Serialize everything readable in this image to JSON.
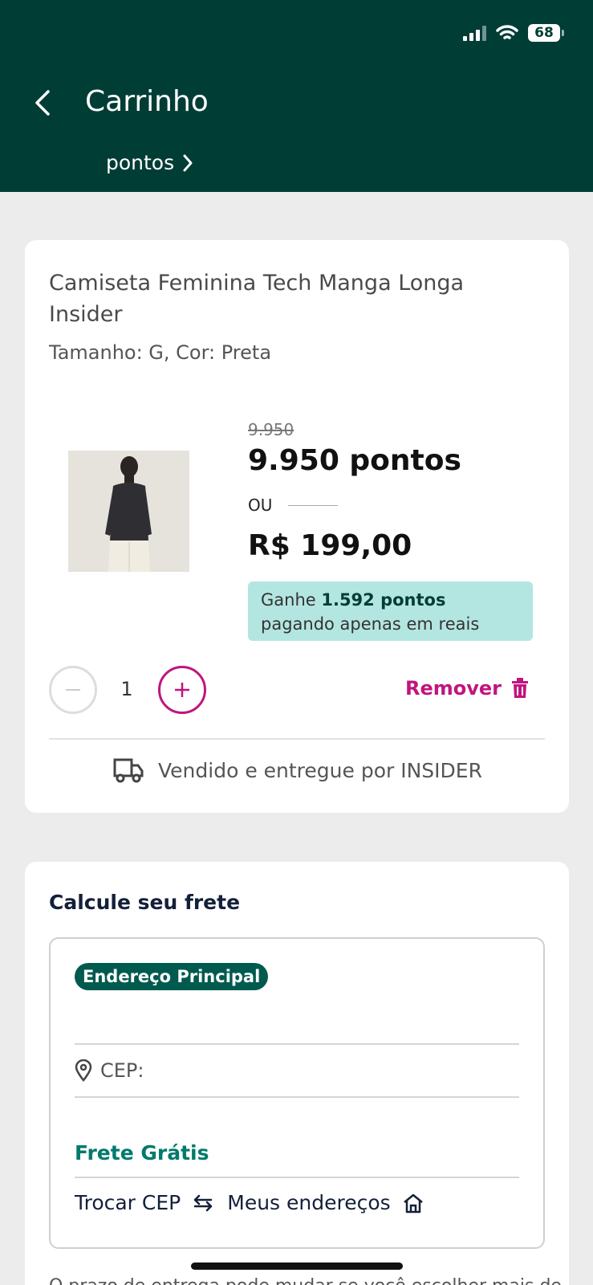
{
  "status_bar": {
    "battery": "68"
  },
  "header": {
    "title": "Carrinho",
    "points_label": "pontos"
  },
  "product": {
    "name": "Camiseta Feminina Tech Manga Longa Insider",
    "variant": "Tamanho: G, Cor: Preta",
    "old_price": "9.950",
    "points_price": "9.950 pontos",
    "or_label": "OU",
    "brl_price": "R$ 199,00",
    "promo_prefix": "Ganhe ",
    "promo_points": "1.592 pontos",
    "promo_suffix": " pagando apenas em reais",
    "quantity": "1",
    "remove_label": "Remover",
    "seller": "Vendido e entregue por INSIDER"
  },
  "shipping": {
    "title": "Calcule seu frete",
    "badge": "Endereço Principal",
    "cep_label": "CEP:",
    "free_label": "Frete Grátis",
    "change_cep": "Trocar CEP",
    "my_addresses": "Meus endereços",
    "notice": "O prazo de entrega pode mudar se você escolher mais de"
  },
  "colors": {
    "header_bg": "#003d35",
    "accent_magenta": "#c0157e",
    "promo_bg": "#b4e6e1",
    "free_shipping": "#007a6c",
    "badge_bg": "#005a4e"
  },
  "icons": [
    "signal-icon",
    "wifi-icon",
    "battery-icon",
    "back-arrow-icon",
    "chevron-right-icon",
    "minus-icon",
    "plus-icon",
    "trash-icon",
    "truck-icon",
    "location-pin-icon",
    "swap-arrows-icon",
    "home-icon"
  ]
}
